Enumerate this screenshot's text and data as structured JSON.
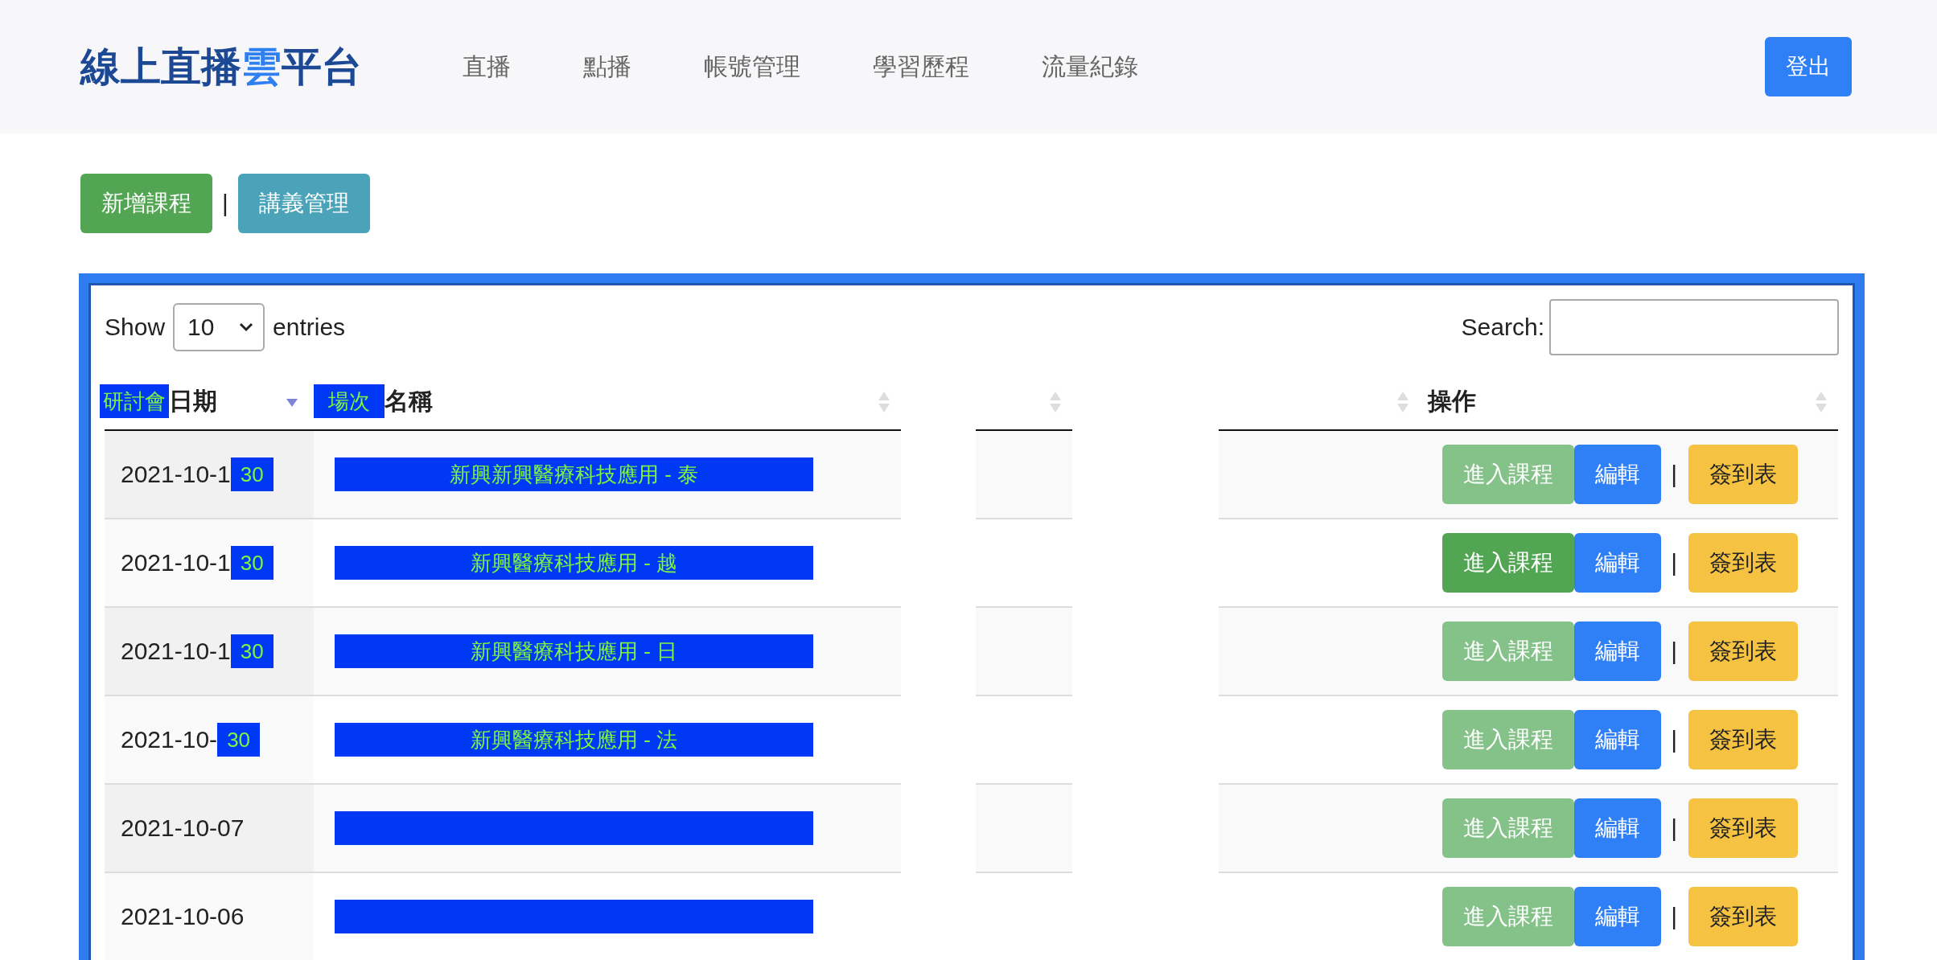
{
  "brand": {
    "parts": [
      {
        "text": "線上直播",
        "accent": false
      },
      {
        "text": "雲",
        "accent": true
      },
      {
        "text": "平台",
        "accent": false
      }
    ]
  },
  "nav": [
    "直播",
    "點播",
    "帳號管理",
    "學習歷程",
    "流量紀錄"
  ],
  "logout": "登出",
  "toolbar": {
    "buttons": [
      {
        "label": "新增課程",
        "kind": "success"
      },
      {
        "label": "講義管理",
        "kind": "info"
      }
    ],
    "separator": "|"
  },
  "table": {
    "show_label": "Show",
    "page_size": "10",
    "entries_label": "entries",
    "search_label": "Search:",
    "columns": [
      {
        "kind": "date",
        "overlay": "研討會",
        "label": "日期",
        "sorted": true
      },
      {
        "kind": "name",
        "overlay": "場次",
        "label": "名稱",
        "sorted": false
      },
      {
        "kind": "blank",
        "sorted": false
      },
      {
        "kind": "blank",
        "sorted": false
      },
      {
        "kind": "actions",
        "label": "操作",
        "sorted": false
      }
    ],
    "rows": [
      {
        "date": "2021-10-1",
        "date_overlay": "30",
        "name_overlay": "新興新興醫療科技應用 - 泰",
        "enter": "進入課程",
        "enter_highlighted": false,
        "edit": "編輯",
        "separator": "|",
        "signin": "簽到表"
      },
      {
        "date": "2021-10-1",
        "date_overlay": "30",
        "name_overlay": "新興醫療科技應用 - 越",
        "enter": "進入課程",
        "enter_highlighted": true,
        "edit": "編輯",
        "separator": "|",
        "signin": "簽到表"
      },
      {
        "date": "2021-10-1",
        "date_overlay": "30",
        "name_overlay": "新興醫療科技應用 - 日",
        "enter": "進入課程",
        "enter_highlighted": false,
        "edit": "編輯",
        "separator": "|",
        "signin": "簽到表"
      },
      {
        "date": "2021-10-",
        "date_overlay": "30",
        "name_overlay": "新興醫療科技應用 - 法",
        "enter": "進入課程",
        "enter_highlighted": false,
        "edit": "編輯",
        "separator": "|",
        "signin": "簽到表"
      },
      {
        "date": "2021-10-07",
        "enter": "進入課程",
        "enter_highlighted": false,
        "edit": "編輯",
        "separator": "|",
        "signin": "簽到表"
      },
      {
        "date": "2021-10-06",
        "enter": "進入課程",
        "enter_highlighted": false,
        "edit": "編輯",
        "separator": "|",
        "signin": "簽到表"
      }
    ]
  }
}
